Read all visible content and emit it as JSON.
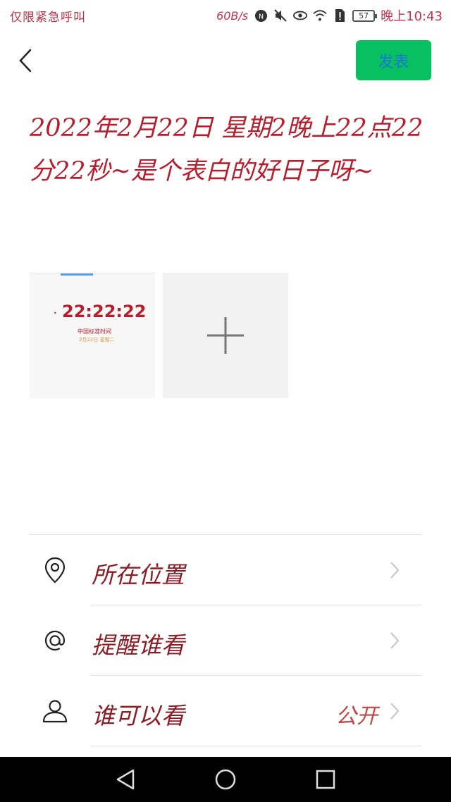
{
  "status_bar": {
    "carrier_text": "仅限紧急呼叫",
    "net_speed": "60B/s",
    "battery_level": "57",
    "time": "晚上10:43"
  },
  "header": {
    "publish_label": "发表"
  },
  "post": {
    "text": "2022年2月22日 星期2晚上22点22分22秒~是个表白的好日子呀~"
  },
  "images": {
    "thumb_time": "22:22:22",
    "thumb_caption": "中国标准时间",
    "thumb_sub": "2月22日 星期二"
  },
  "options": [
    {
      "label": "所在位置",
      "value": "",
      "icon": "location-pin-icon"
    },
    {
      "label": "提醒谁看",
      "value": "",
      "icon": "at-icon"
    },
    {
      "label": "谁可以看",
      "value": "公开",
      "icon": "person-icon"
    }
  ]
}
